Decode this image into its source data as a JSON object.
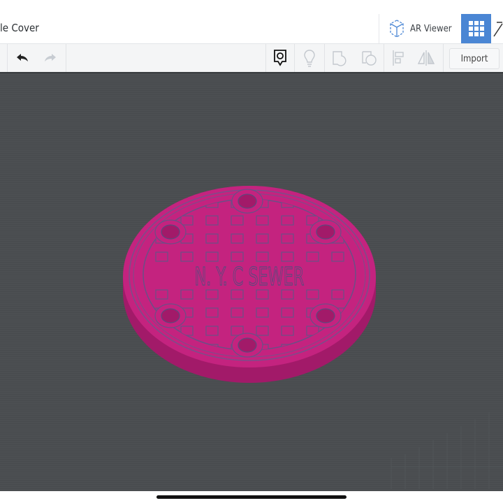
{
  "header": {
    "title": "le Cover",
    "ar_viewer_label": "AR Viewer",
    "grid_view_icon": "grid-icon",
    "edit_icon": "pencil-ruler-icon"
  },
  "toolbar": {
    "undo_icon": "undo-icon",
    "redo_icon": "redo-icon",
    "tools": [
      "notes-icon",
      "light-bulb-icon",
      "shape-icon",
      "group-icon",
      "align-icon",
      "mirror-icon"
    ],
    "import_label": "Import"
  },
  "model": {
    "emboss_text": "N. Y. C SEWER",
    "color": "#c4237f",
    "side_color": "#a91c6e",
    "viewport_color": "#4c4f52"
  }
}
